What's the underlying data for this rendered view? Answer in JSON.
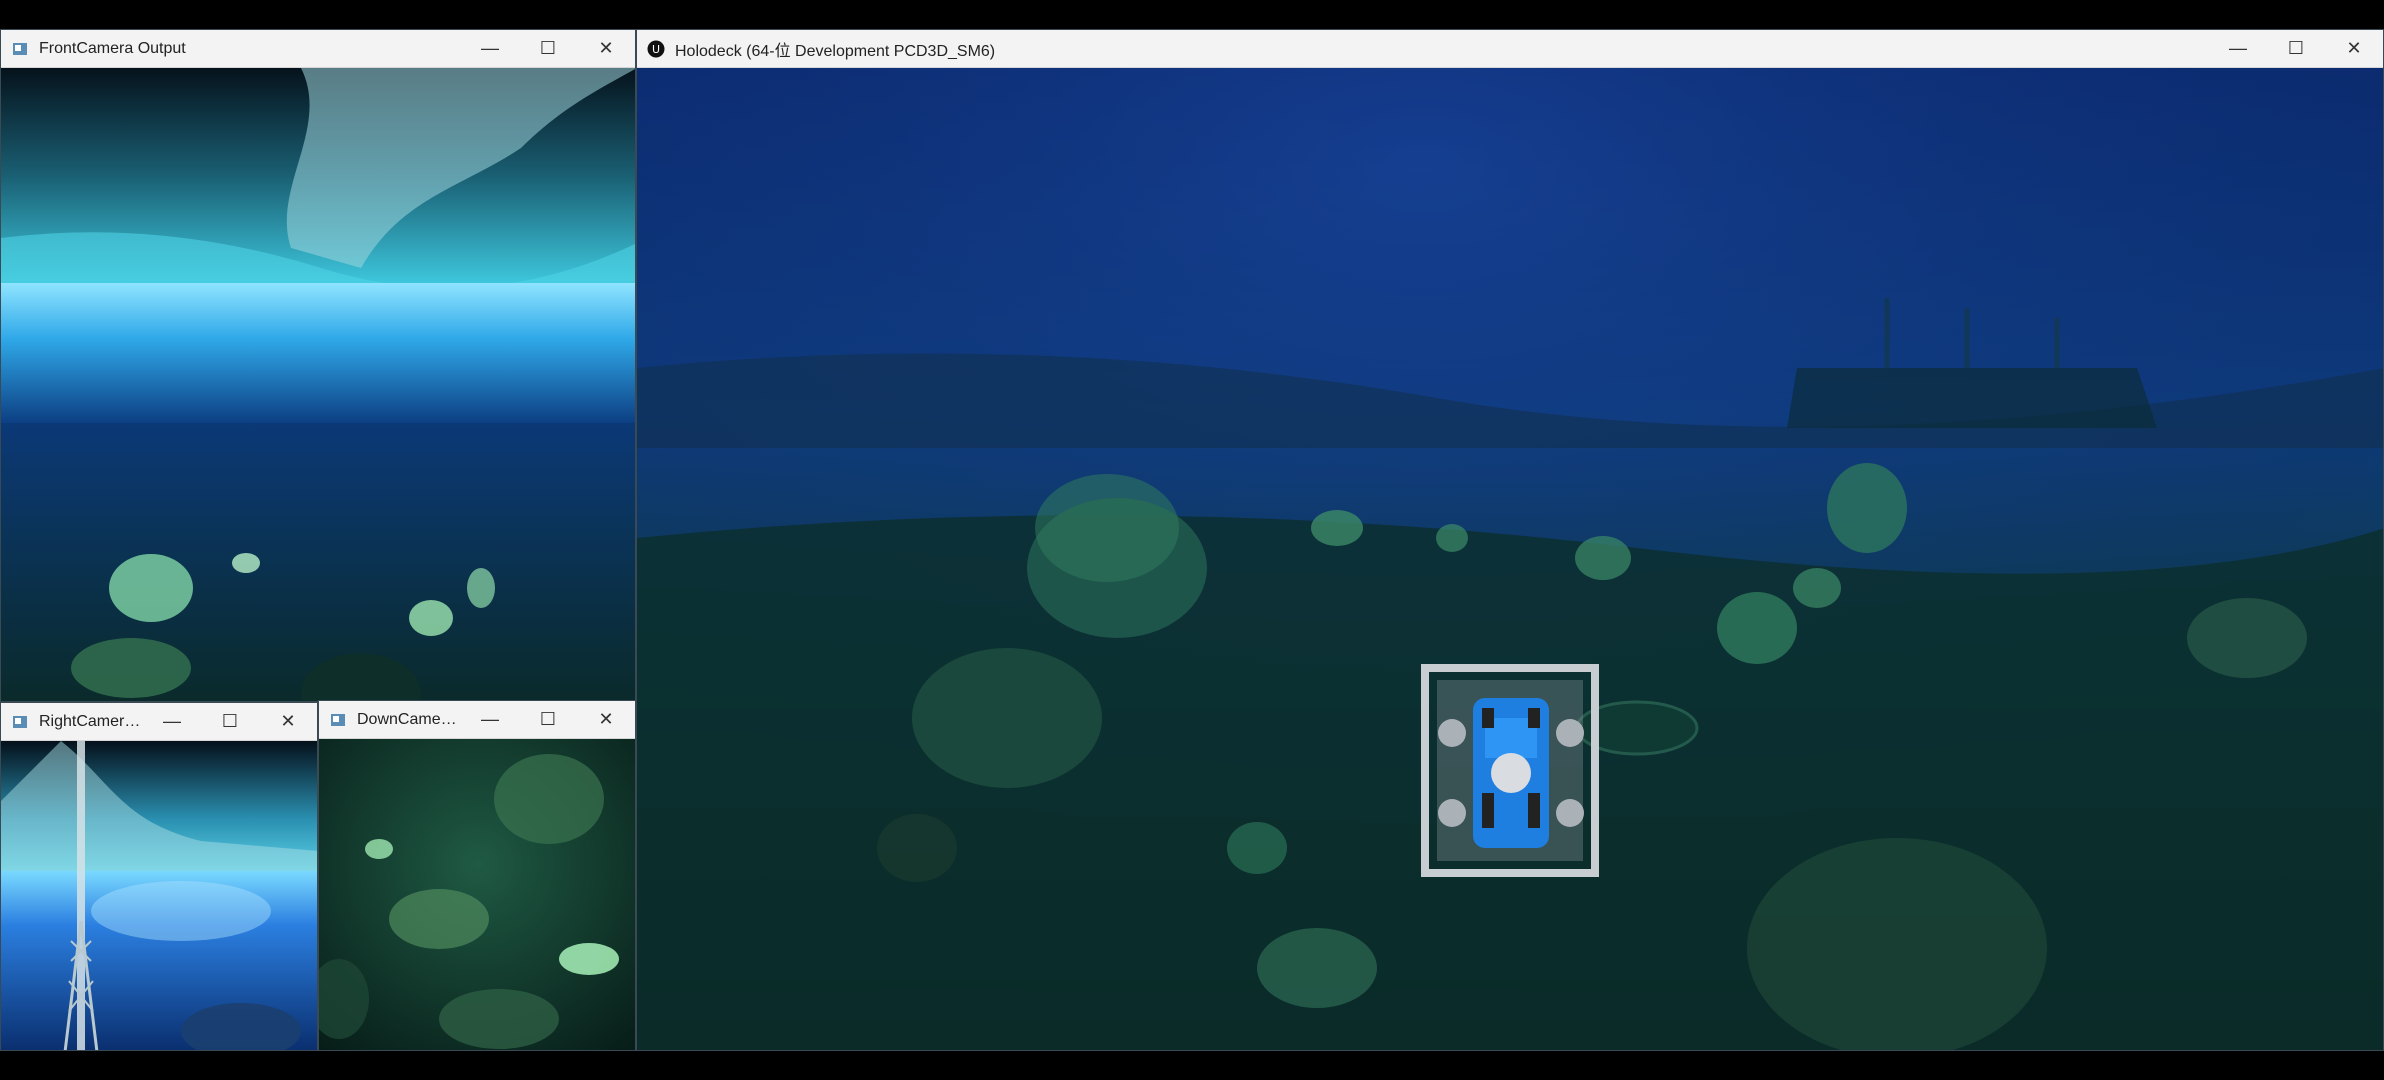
{
  "windows": {
    "front": {
      "title": "FrontCamera Output"
    },
    "right": {
      "title": "RightCamera..."
    },
    "down": {
      "title": "DownCamera..."
    },
    "main": {
      "title": "Holodeck   (64-位 Development PCD3D_SM6)"
    }
  },
  "controls": {
    "minimize": "—",
    "maximize": "☐",
    "close": "✕"
  },
  "colors": {
    "water_deep": "#0b2a6e",
    "water_mid": "#0d3a7a",
    "seabed": "#0e3a38",
    "surface": "#2fa8e8",
    "rov_blue": "#1e7fe0"
  }
}
